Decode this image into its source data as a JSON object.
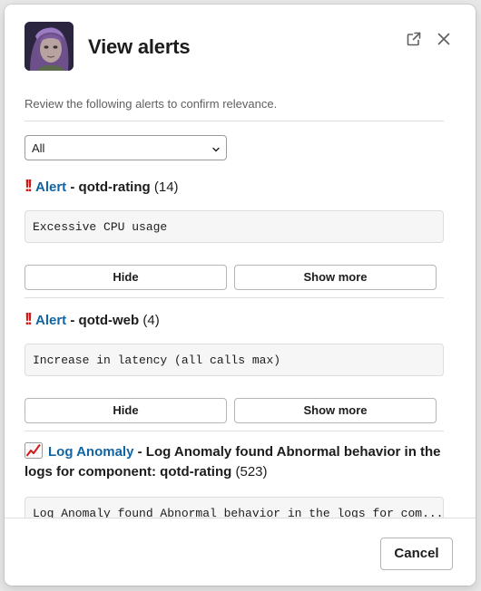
{
  "modal": {
    "title": "View alerts",
    "subtitle": "Review the following alerts to confirm relevance."
  },
  "filter": {
    "selected": "All"
  },
  "alerts": [
    {
      "icon": "double-exclamation-icon",
      "link_label": "Alert",
      "separator": " - ",
      "name": "qotd-rating",
      "count": "(14)",
      "message": "Excessive CPU usage",
      "hide_label": "Hide",
      "show_more_label": "Show more"
    },
    {
      "icon": "double-exclamation-icon",
      "link_label": "Alert",
      "separator": " - ",
      "name": "qotd-web",
      "count": "(4)",
      "message": "Increase in latency (all calls max)",
      "hide_label": "Hide",
      "show_more_label": "Show more"
    },
    {
      "icon": "chart-increasing-icon",
      "link_label": "Log Anomaly",
      "separator": " - ",
      "name": "Log Anomaly found Abnormal behavior in the logs for component: qotd-rating",
      "count": "(523)",
      "message": "Log Anomaly found Abnormal behavior in the logs for com..."
    }
  ],
  "footer": {
    "cancel_label": "Cancel"
  },
  "colors": {
    "link": "#1264a3",
    "alert_red": "#d11a1a"
  }
}
